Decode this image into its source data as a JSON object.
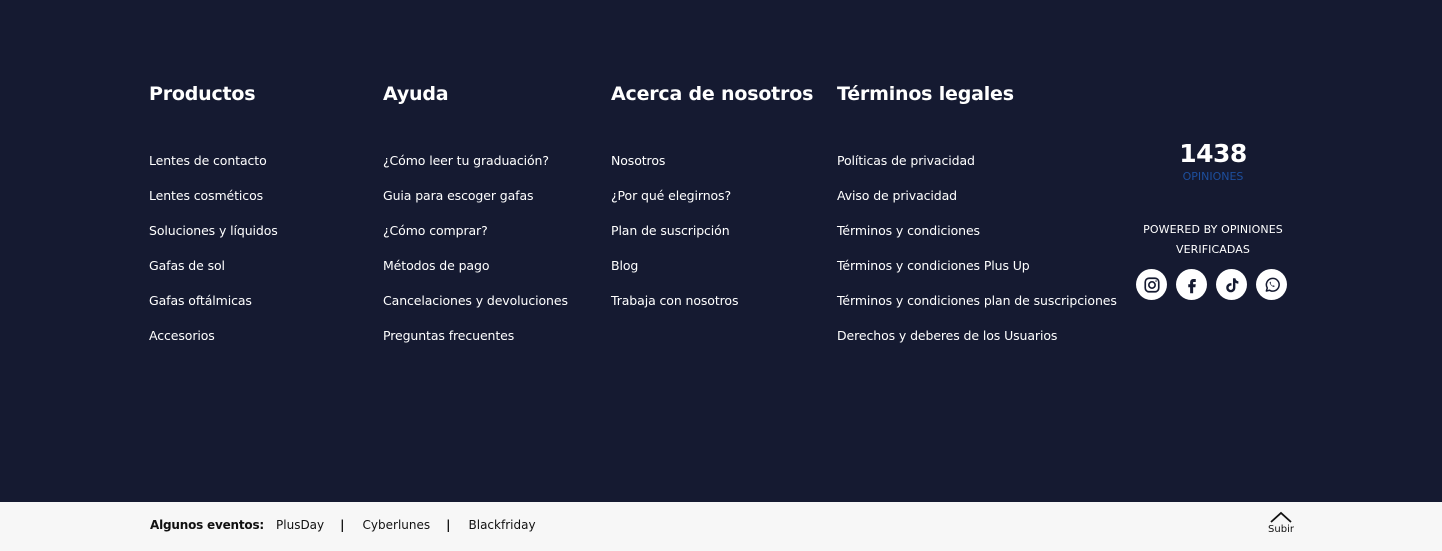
{
  "columns": {
    "productos": {
      "title": "Productos",
      "links": [
        "Lentes de contacto",
        "Lentes cosméticos",
        "Soluciones y líquidos",
        "Gafas de sol",
        "Gafas oftálmicas",
        "Accesorios"
      ]
    },
    "ayuda": {
      "title": "Ayuda",
      "links": [
        "¿Cómo leer tu graduación?",
        "Guia para escoger gafas",
        "¿Cómo comprar?",
        "Métodos de pago",
        "Cancelaciones y devoluciones",
        "Preguntas frecuentes"
      ]
    },
    "acerca": {
      "title": "Acerca de nosotros",
      "links": [
        "Nosotros",
        "¿Por qué elegirnos?",
        "Plan de suscripción",
        "Blog",
        "Trabaja con nosotros"
      ]
    },
    "legales": {
      "title": "Términos legales",
      "links": [
        "Políticas de privacidad",
        "Aviso de privacidad",
        "Términos y condiciones",
        "Términos y condiciones Plus Up",
        "Términos y condiciones plan de suscripciones",
        "Derechos y deberes de los Usuarios"
      ]
    }
  },
  "reviews": {
    "count": "1438",
    "label": "OPINIONES",
    "powered_line1": "POWERED BY OPINIONES",
    "powered_line2": "VERIFICADAS"
  },
  "social": [
    {
      "icon": "instagram-icon"
    },
    {
      "icon": "facebook-icon"
    },
    {
      "icon": "tiktok-icon"
    },
    {
      "icon": "whatsapp-icon"
    }
  ],
  "bottom_bar": {
    "events_label": "Algunos eventos:",
    "events": [
      "PlusDay",
      "Cyberlunes",
      "Blackfriday"
    ],
    "separator": "|",
    "back_to_top_label": "Subir"
  },
  "colors": {
    "footer_bg": "#151a31",
    "bottom_bg": "#f7f7f7",
    "reviews_label": "#1d4f9e"
  }
}
